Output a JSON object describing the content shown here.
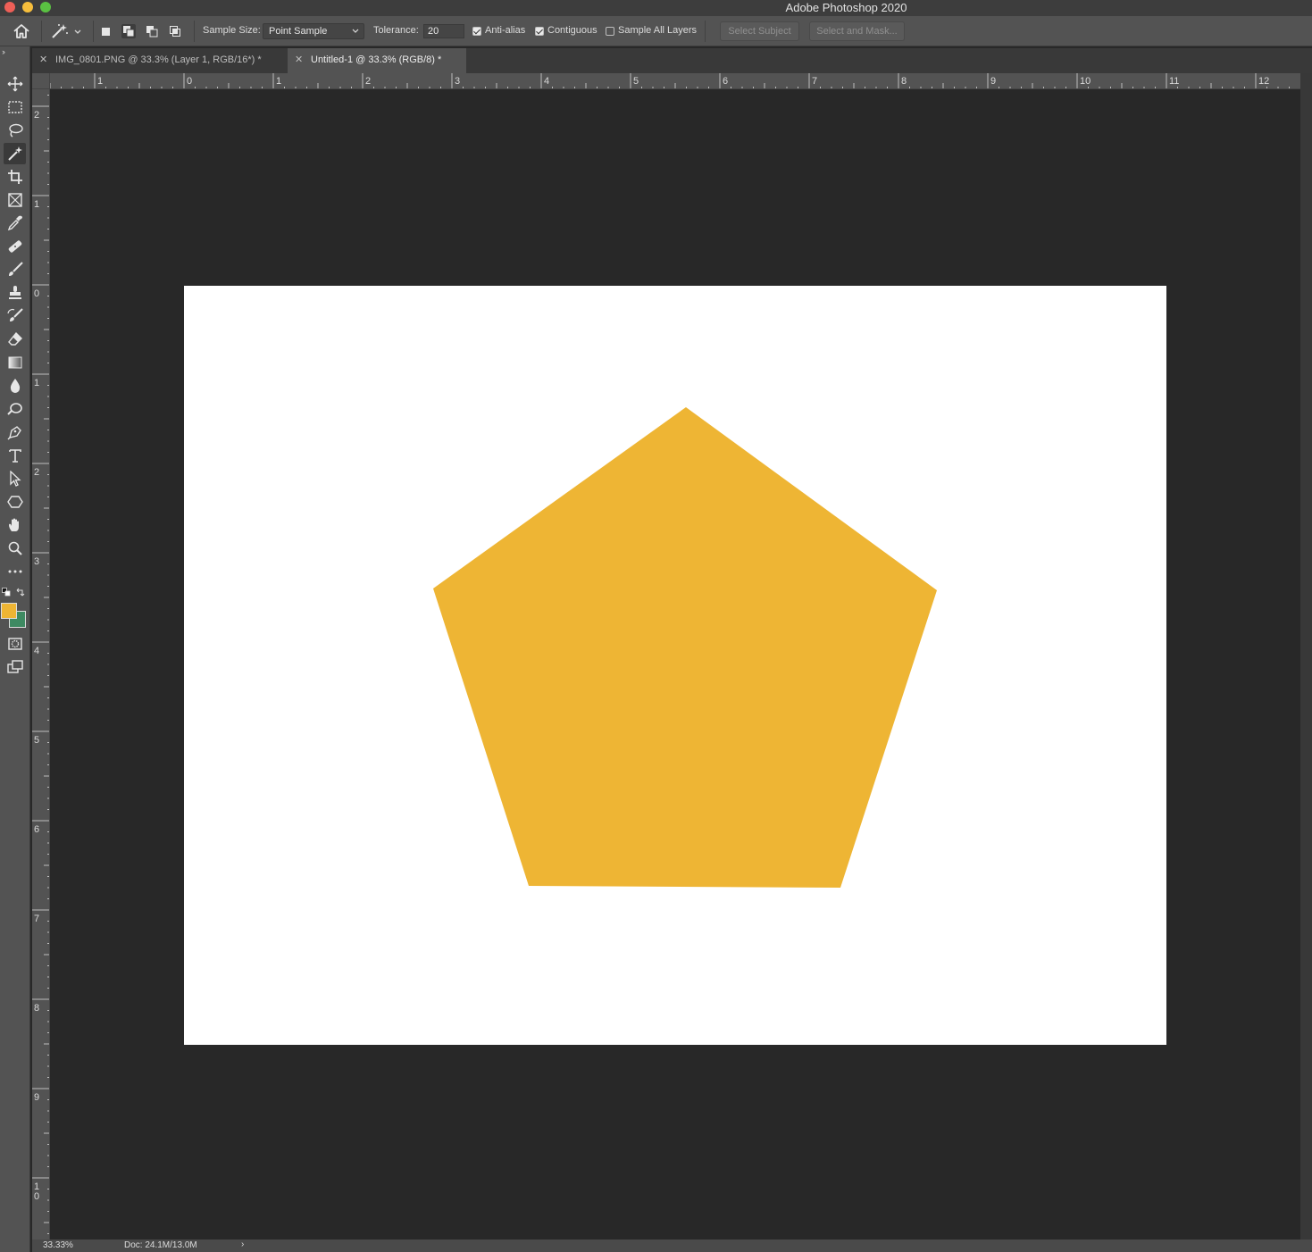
{
  "window": {
    "title": "Adobe Photoshop 2020"
  },
  "options_bar": {
    "sample_size_label": "Sample Size:",
    "sample_size_value": "Point Sample",
    "tolerance_label": "Tolerance:",
    "tolerance_value": "20",
    "anti_alias": {
      "label": "Anti-alias",
      "checked": true
    },
    "contiguous": {
      "label": "Contiguous",
      "checked": true
    },
    "sample_all_layers": {
      "label": "Sample All Layers",
      "checked": false
    },
    "select_subject_label": "Select Subject",
    "select_and_mask_label": "Select and Mask..."
  },
  "tabs": [
    {
      "label": "IMG_0801.PNG @ 33.3% (Layer 1, RGB/16*) *",
      "active": false
    },
    {
      "label": "Untitled-1 @ 33.3% (RGB/8) *",
      "active": true
    }
  ],
  "rulers": {
    "horizontal_labels": [
      "1",
      "0",
      "1",
      "2",
      "3",
      "4",
      "5",
      "6",
      "7",
      "8",
      "9",
      "10",
      "11",
      "12"
    ],
    "vertical_labels": [
      "2",
      "1",
      "0",
      "1",
      "2",
      "3",
      "4",
      "5",
      "6",
      "7",
      "8",
      "9",
      "10"
    ]
  },
  "colors": {
    "foreground": "#eeb534",
    "background": "#3e8a62",
    "shape_fill": "#eeb534",
    "canvas": "#ffffff"
  },
  "status": {
    "zoom": "33.33%",
    "doc_size": "Doc: 24.1M/13.0M"
  }
}
